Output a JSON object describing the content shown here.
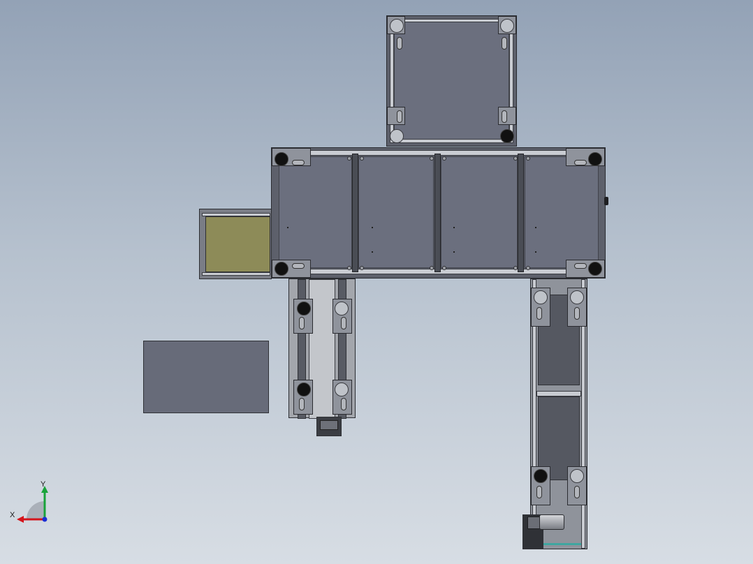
{
  "viewport": {
    "title": "",
    "background": "#a9b5c3"
  },
  "triad": {
    "x_label": "X",
    "y_label": "Y",
    "x_color": "#d4141b",
    "y_color": "#19a33a",
    "z_color": "#1b2fd4"
  },
  "model": {
    "accent_material": "#8d8b58",
    "panel_color": "#6b6f7e",
    "frame_color": "#5d606b"
  }
}
